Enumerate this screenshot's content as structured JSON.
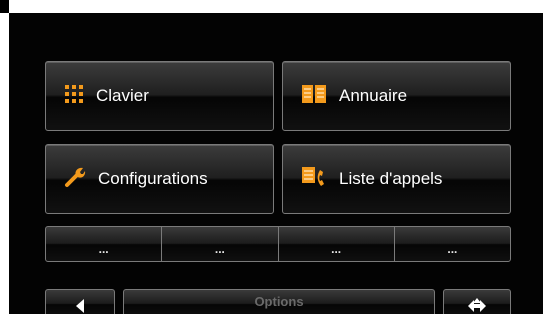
{
  "menu": {
    "keypad_label": "Clavier",
    "directory_label": "Annuaire",
    "settings_label": "Configurations",
    "call_list_label": "Liste d'appels"
  },
  "quick_slots": [
    "...",
    "...",
    "...",
    "..."
  ],
  "bottom_bar": {
    "options_label": "Options"
  },
  "icons": {
    "keypad": "keypad-grid-icon",
    "directory": "book-icon",
    "settings": "wrench-icon",
    "call_list": "phone-list-icon",
    "back": "left-arrow-icon",
    "move": "four-way-arrow-icon"
  },
  "colors": {
    "background": "#030303",
    "icon_orange": "#f39a1c",
    "text": "#ffffff",
    "disabled_text": "#6a6a6a"
  }
}
